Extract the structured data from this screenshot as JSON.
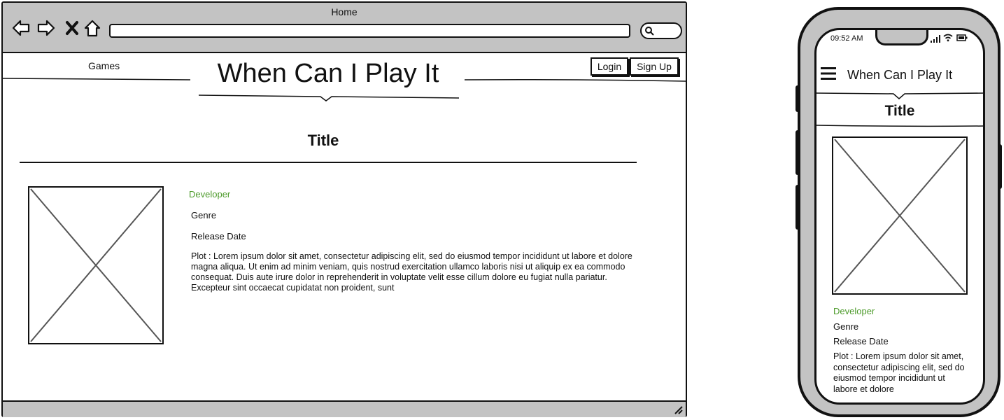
{
  "browser": {
    "window_title": "Home",
    "nav": {
      "games_label": "Games"
    },
    "site_title": "When Can I Play It",
    "login_label": "Login",
    "signup_label": "Sign Up"
  },
  "game": {
    "title": "Title",
    "developer": "Developer",
    "genre": "Genre",
    "release_date": "Release Date",
    "plot": "Plot : Lorem ipsum dolor sit amet, consectetur adipiscing elit, sed do eiusmod tempor incididunt ut labore et dolore magna aliqua. Ut enim ad minim veniam, quis nostrud exercitation ullamco laboris nisi ut aliquip ex ea commodo consequat. Duis aute irure dolor in reprehenderit in voluptate velit esse cillum dolore eu fugiat nulla pariatur. Excepteur sint occaecat cupidatat non proident, sunt"
  },
  "mobile": {
    "time": "09:52 AM",
    "site_title": "When Can I Play It",
    "title": "Title",
    "developer": "Developer",
    "genre": "Genre",
    "release_date": "Release Date",
    "plot": "Plot : Lorem ipsum dolor sit amet, consectetur adipiscing elit, sed do eiusmod tempor incididunt ut labore et dolore"
  },
  "colors": {
    "accent_link": "#4c9a2a",
    "chrome": "#c3c3c3"
  },
  "icons": [
    "back-icon",
    "forward-icon",
    "close-icon",
    "home-icon",
    "search-icon",
    "resize-grip-icon",
    "hamburger-menu-icon",
    "signal-icon",
    "wifi-icon",
    "battery-icon",
    "image-placeholder"
  ]
}
